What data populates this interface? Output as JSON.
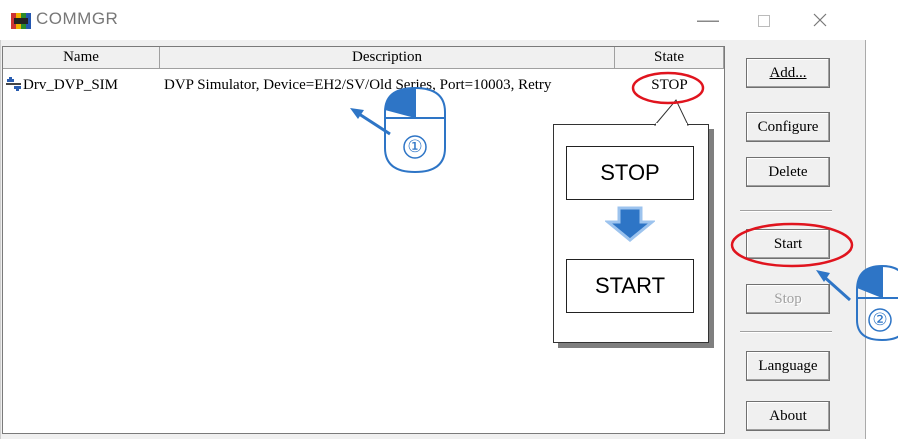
{
  "window": {
    "title": "COMMGR",
    "minimize_icon": "minimize-icon",
    "maximize_icon": "maximize-icon",
    "close_icon": "close-icon"
  },
  "list": {
    "columns": [
      "Name",
      "Description",
      "State"
    ],
    "rows": [
      {
        "icon": "driver-icon",
        "name": "Drv_DVP_SIM",
        "description": "DVP Simulator, Device=EH2/SV/Old Series, Port=10003, Retry",
        "state": "STOP"
      }
    ]
  },
  "buttons": {
    "add": "Add...",
    "configure": "Configure",
    "delete": "Delete",
    "start": "Start",
    "stop": "Stop",
    "language": "Language",
    "about": "About"
  },
  "annotation": {
    "state_before": "STOP",
    "state_after": "START",
    "step1_label": "①",
    "step2_label": "②",
    "highlight_color": "#e0141e",
    "arrow_color": "#2e75c6"
  }
}
